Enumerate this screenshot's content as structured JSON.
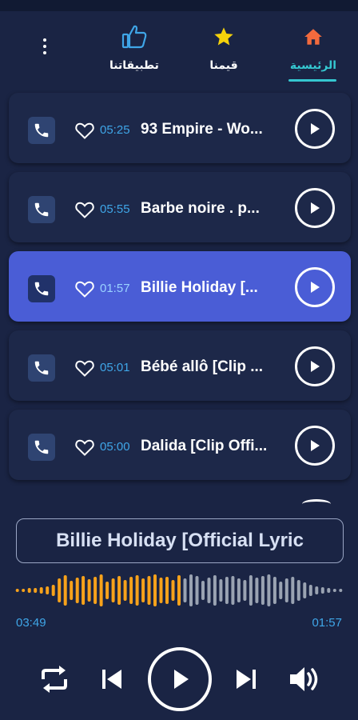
{
  "nav": {
    "tabs": [
      {
        "label": "الرئيسية",
        "icon": "home-icon",
        "active": true
      },
      {
        "label": "قيمنا",
        "icon": "star-icon",
        "active": false
      },
      {
        "label": "تطبيقاتنا",
        "icon": "thumbs-up-icon",
        "active": false
      }
    ],
    "menu_icon": "more-vertical-icon"
  },
  "tracks": [
    {
      "title": "93 Empire - Wo...",
      "duration": "05:25",
      "active": false
    },
    {
      "title": "Barbe noire  . p...",
      "duration": "05:55",
      "active": false
    },
    {
      "title": "Billie Holiday [...",
      "duration": "01:57",
      "active": true
    },
    {
      "title": "Bébé allô [Clip ...",
      "duration": "05:01",
      "active": false
    },
    {
      "title": "Dalida [Clip Offi...",
      "duration": "05:00",
      "active": false
    }
  ],
  "player": {
    "now_playing": "Billie Holiday [Official Lyric",
    "elapsed": "03:49",
    "total": "01:57",
    "progress": 0.5
  },
  "colors": {
    "background": "#1a2444",
    "card": "#1d2849",
    "active_card": "#4a5dd6",
    "accent": "#35c7d0",
    "time_text": "#3fa6e8",
    "wave_played": "#f7a21b",
    "wave_remaining": "#9aa3b2",
    "home_icon": "#f26a3d",
    "star_icon": "#f5d20b",
    "thumb_icon": "#3fa6e8"
  }
}
